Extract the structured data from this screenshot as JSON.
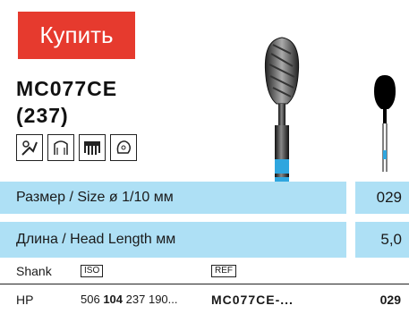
{
  "buy_button": {
    "label": "Купить"
  },
  "product": {
    "code": "MC077CE",
    "number": "(237)"
  },
  "icons": [
    "surgery-icon",
    "crown-prep-icon",
    "denture-icon",
    "model-icon"
  ],
  "colors": {
    "buy": "#e63a2e",
    "band": "#aee0f5",
    "bur_blue": "#2fa6df"
  },
  "specs": [
    {
      "label": "Размер / Size ø 1/10 мм",
      "value": "029"
    },
    {
      "label": "Длина / Head Length мм",
      "value": "5,0"
    }
  ],
  "shank_header": {
    "label": "Shank",
    "iso": "ISO",
    "ref": "REF"
  },
  "hp_row": {
    "type": "HP",
    "iso_pre": "506",
    "iso_bold": "104",
    "iso_post": "237 190...",
    "ref": "MC077CE-...",
    "size": "029"
  }
}
